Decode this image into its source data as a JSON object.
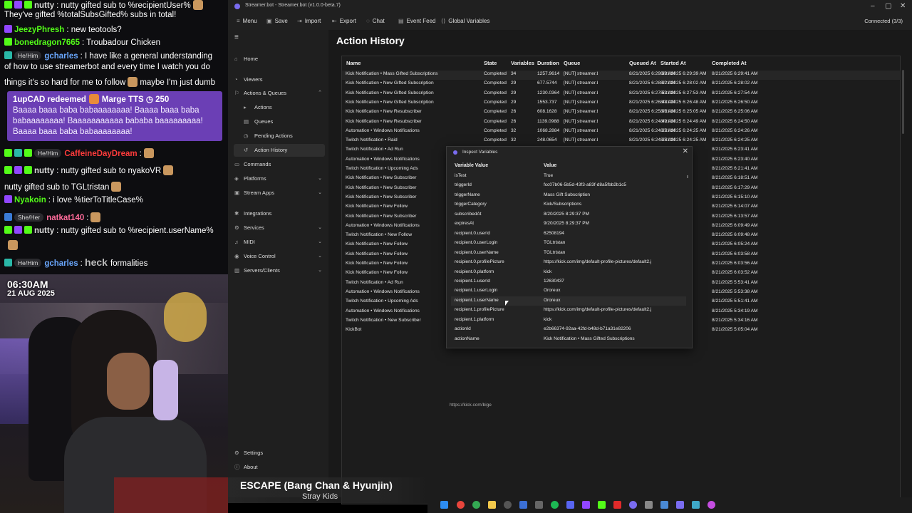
{
  "chat": {
    "lines": [
      {
        "user": "nutty",
        "text": ": nutty gifted sub to %recipientUser%",
        "color": "#d9d9d9"
      },
      {
        "user": "",
        "text": "They've gifted %totalSubsGifted% subs in total!",
        "color": "#ffffff"
      },
      {
        "user": "JeezyPhresh",
        "text": ": new teotools?",
        "color": "#53fc18"
      },
      {
        "user": "bonedragon7665",
        "text": ": Troubadour Chicken",
        "color": "#53fc18"
      },
      {
        "pronoun": "He/Him",
        "user": "gcharles",
        "text": ": I have like a general understanding",
        "color": "#6aa8ff"
      },
      {
        "user": "",
        "text": "of how to use streamerbot and every time I watch you do",
        "color": "#ffffff"
      },
      {
        "user": "",
        "text": "things it's so hard for me to follow",
        "text2": "maybe I'm just dumb",
        "color": "#ffffff"
      }
    ],
    "redeem": {
      "title": "1upCAD redeemed",
      "reward": "Marge TTS",
      "cost": "250",
      "body": "Baaaa baaa baba babaaaaaaaa! Baaaa baaa baba babaaaaaaaa! Baaaaaaaaaaa bababa baaaaaaaaa! Baaaa baaa baba babaaaaaaaa!"
    },
    "lines2": [
      {
        "pronoun": "He/Him",
        "user": "CaffeineDayDream",
        "text": ":",
        "color": "#ff3b3b"
      },
      {
        "user": "nutty",
        "text": ": nutty gifted sub to nyakoVR",
        "color": "#d9d9d9"
      },
      {
        "user": "",
        "text": "nutty gifted sub to TGLtristan",
        "color": "#ffffff"
      },
      {
        "user": "Nyakoin",
        "text": ": i love %tierToTitleCase%",
        "color": "#53fc18"
      },
      {
        "pronoun": "She/Her",
        "user": "natkat140",
        "text": ":",
        "color": "#ff6b9a"
      },
      {
        "user": "nutty",
        "text": ": nutty gifted sub to %recipient.userName%",
        "color": "#d9d9d9"
      },
      {
        "pronoun": "He/Him",
        "user": "gcharles",
        "heck": "heck",
        "text": "formalities",
        "color": "#6aa8ff"
      }
    ]
  },
  "cam": {
    "time": "06:30AM",
    "date": "21 AUG 2025"
  },
  "app": {
    "title": "Streamer.bot - Streamer.bot (v1.0.0-beta.7)",
    "toolbar": [
      "Menu",
      "Save",
      "Import",
      "Export",
      "Chat",
      "Event Feed",
      "Global Variables"
    ],
    "connection": "Connected (3/3)",
    "page_title": "Action History",
    "link_hint": "https://kick.com/bige"
  },
  "sidebar": [
    {
      "label": "Home",
      "icon": "home-icon",
      "glyph": "⌂",
      "sub": false
    },
    {
      "label": "Viewers",
      "icon": "viewers-icon",
      "glyph": "◔",
      "sub": false
    },
    {
      "label": "Actions & Queues",
      "icon": "actions-icon",
      "glyph": "⚐",
      "sub": false,
      "chev": "⌃"
    },
    {
      "label": "Actions",
      "icon": "action-icon",
      "glyph": "▸",
      "sub": true
    },
    {
      "label": "Queues",
      "icon": "queue-icon",
      "glyph": "▤",
      "sub": true
    },
    {
      "label": "Pending Actions",
      "icon": "pending-icon",
      "glyph": "◷",
      "sub": true
    },
    {
      "label": "Action History",
      "icon": "history-icon",
      "glyph": "↺",
      "sub": true,
      "active": true
    },
    {
      "label": "Commands",
      "icon": "commands-icon",
      "glyph": "▭",
      "sub": false
    },
    {
      "label": "Platforms",
      "icon": "platforms-icon",
      "glyph": "◈",
      "sub": false,
      "chev": "⌄"
    },
    {
      "label": "Stream Apps",
      "icon": "apps-icon",
      "glyph": "▣",
      "sub": false,
      "chev": "⌄"
    },
    {
      "label": "Integrations",
      "icon": "integrations-icon",
      "glyph": "✱",
      "sub": false
    },
    {
      "label": "Services",
      "icon": "services-icon",
      "glyph": "⚙",
      "sub": false,
      "chev": "⌄"
    },
    {
      "label": "MIDI",
      "icon": "midi-icon",
      "glyph": "♫",
      "sub": false,
      "chev": "⌄"
    },
    {
      "label": "Voice Control",
      "icon": "voice-icon",
      "glyph": "◉",
      "sub": false,
      "chev": "⌄"
    },
    {
      "label": "Servers/Clients",
      "icon": "servers-icon",
      "glyph": "▥",
      "sub": false,
      "chev": "⌄"
    }
  ],
  "sidebar_bottom": [
    {
      "label": "Settings",
      "icon": "settings-icon",
      "glyph": "⚙"
    },
    {
      "label": "About",
      "icon": "info-icon",
      "glyph": "ⓘ"
    }
  ],
  "grid": {
    "headers": [
      "Name",
      "State",
      "Variables",
      "Duration",
      "Queue",
      "Queued At",
      "Started At",
      "Completed At"
    ],
    "rows": [
      [
        "Kick Notification • Mass Gifted Subscriptions",
        "Completed",
        "34",
        "1257.9614",
        "[NUT] streamer.bo",
        "8/21/2025 6:29:39 AM",
        "8/21/2025 6:29:39 AM",
        "8/21/2025 6:29:41 AM"
      ],
      [
        "Kick Notification • New Gifted Subscription",
        "Completed",
        "29",
        "677.5744",
        "[NUT] streamer.bo",
        "8/21/2025 6:28:02 AM",
        "8/21/2025 6:28:02 AM",
        "8/21/2025 6:28:02 AM"
      ],
      [
        "Kick Notification • New Gifted Subscription",
        "Completed",
        "29",
        "1230.0364",
        "[NUT] streamer.bo",
        "8/21/2025 6:27:53 AM",
        "8/21/2025 6:27:53 AM",
        "8/21/2025 6:27:54 AM"
      ],
      [
        "Kick Notification • New Gifted Subscription",
        "Completed",
        "29",
        "1553.737",
        "[NUT] streamer.bo",
        "8/21/2025 6:26:48 AM",
        "8/21/2025 6:26:48 AM",
        "8/21/2025 6:26:50 AM"
      ],
      [
        "Kick Notification • New Resubscriber",
        "Completed",
        "26",
        "608.1628",
        "[NUT] streamer.bo",
        "8/21/2025 6:25:05 AM",
        "8/21/2025 6:25:05 AM",
        "8/21/2025 6:25:06 AM"
      ],
      [
        "Kick Notification • New Resubscriber",
        "Completed",
        "26",
        "1139.0988",
        "[NUT] streamer.bo",
        "8/21/2025 6:24:49 AM",
        "8/21/2025 6:24:49 AM",
        "8/21/2025 6:24:50 AM"
      ],
      [
        "Automation • Windows Notifications",
        "Completed",
        "32",
        "1068.2884",
        "[NUT] streamer.bo",
        "8/21/2025 6:24:25 AM",
        "8/21/2025 6:24:25 AM",
        "8/21/2025 6:24:26 AM"
      ],
      [
        "Twitch Notification • Raid",
        "Completed",
        "32",
        "248.0654",
        "[NUT] streamer.bo",
        "8/21/2025 6:24:25 AM",
        "8/21/2025 6:24:25 AM",
        "8/21/2025 6:24:25 AM"
      ],
      [
        "Twitch Notification • Ad Run",
        "",
        "",
        "",
        "",
        "",
        "",
        "8/21/2025 6:23:41 AM"
      ],
      [
        "Automation • Windows Notifications",
        "",
        "",
        "",
        "",
        "",
        "",
        "8/21/2025 6:23:40 AM"
      ],
      [
        "Twitch Notification • Upcoming Ads",
        "",
        "",
        "",
        "",
        "",
        "",
        "8/21/2025 6:21:41 AM"
      ],
      [
        "Kick Notification • New Subscriber",
        "",
        "",
        "",
        "",
        "",
        "",
        "8/21/2025 6:18:51 AM"
      ],
      [
        "Kick Notification • New Subscriber",
        "",
        "",
        "",
        "",
        "",
        "",
        "8/21/2025 6:17:29 AM"
      ],
      [
        "Kick Notification • New Subscriber",
        "",
        "",
        "",
        "",
        "",
        "",
        "8/21/2025 6:15:10 AM"
      ],
      [
        "Kick Notification • New Follow",
        "",
        "",
        "",
        "",
        "",
        "",
        "8/21/2025 6:14:07 AM"
      ],
      [
        "Kick Notification • New Subscriber",
        "",
        "",
        "",
        "",
        "",
        "",
        "8/21/2025 6:13:57 AM"
      ],
      [
        "Automation • Windows Notifications",
        "",
        "",
        "",
        "",
        "",
        "",
        "8/21/2025 6:09:49 AM"
      ],
      [
        "Twitch Notification • New Follow",
        "",
        "",
        "",
        "",
        "",
        "",
        "8/21/2025 6:09:48 AM"
      ],
      [
        "Kick Notification • New Follow",
        "",
        "",
        "",
        "",
        "",
        "",
        "8/21/2025 6:05:24 AM"
      ],
      [
        "Kick Notification • New Follow",
        "",
        "",
        "",
        "",
        "",
        "",
        "8/21/2025 6:03:58 AM"
      ],
      [
        "Kick Notification • New Follow",
        "",
        "",
        "",
        "",
        "",
        "",
        "8/21/2025 6:03:56 AM"
      ],
      [
        "Kick Notification • New Follow",
        "",
        "",
        "",
        "",
        "",
        "",
        "8/21/2025 6:03:52 AM"
      ],
      [
        "Twitch Notification • Ad Run",
        "",
        "",
        "",
        "",
        "",
        "",
        "8/21/2025 5:53:41 AM"
      ],
      [
        "Automation • Windows Notifications",
        "",
        "",
        "",
        "",
        "",
        "",
        "8/21/2025 5:53:38 AM"
      ],
      [
        "Twitch Notification • Upcoming Ads",
        "",
        "",
        "",
        "",
        "",
        "",
        "8/21/2025 5:51:41 AM"
      ],
      [
        "Automation • Windows Notifications",
        "",
        "",
        "",
        "",
        "",
        "",
        "8/21/2025 5:34:19 AM"
      ],
      [
        "Twitch Notification • New Subscriber",
        "",
        "",
        "",
        "",
        "",
        "",
        "8/21/2025 5:34:16 AM"
      ],
      [
        "KickBot",
        "",
        "",
        "",
        "",
        "",
        "",
        "8/21/2025 5:05:04 AM"
      ]
    ]
  },
  "dialog": {
    "title": "Inspect Variables",
    "headers": [
      "Variable Value",
      "Value"
    ],
    "rows": [
      [
        "isTest",
        "True"
      ],
      [
        "triggerId",
        "fcc07b06-5b5d-43f3-a83f-d8a5fbb2b1c5"
      ],
      [
        "triggerName",
        "Mass Gift Subscription"
      ],
      [
        "triggerCategory",
        "Kick/Subscriptions"
      ],
      [
        "subscribedAt",
        "8/20/2025 8:29:37 PM"
      ],
      [
        "expiresAt",
        "9/20/2025 8:29:37 PM"
      ],
      [
        "recipient.0.userId",
        "62508194"
      ],
      [
        "recipient.0.userLogin",
        "TGLtristan"
      ],
      [
        "recipient.0.userName",
        "TGLtristan"
      ],
      [
        "recipient.0.profilePicture",
        "https://kick.com/img/default-profile-pictures/default2.j"
      ],
      [
        "recipient.0.platform",
        "kick"
      ],
      [
        "recipient.1.userId",
        "12630437"
      ],
      [
        "recipient.1.userLogin",
        "Ororeux"
      ],
      [
        "recipient.1.userName",
        "Ororeux"
      ],
      [
        "recipient.1.profilePicture",
        "https://kick.com/img/default-profile-pictures/default2.j"
      ],
      [
        "recipient.1.platform",
        "kick"
      ],
      [
        "actionId",
        "e2b66374-92aa-42fd-b48d-b71a31e82206"
      ],
      [
        "actionName",
        "Kick Notification • Mass Gifted Subscriptions"
      ]
    ]
  },
  "now_playing": {
    "title": "ESCAPE (Bang Chan & Hyunjin)",
    "artist": "Stray Kids"
  },
  "colors": {
    "accent": "#7a6cf0",
    "kick_green": "#53fc18",
    "redeem": "#6b3fb5"
  }
}
